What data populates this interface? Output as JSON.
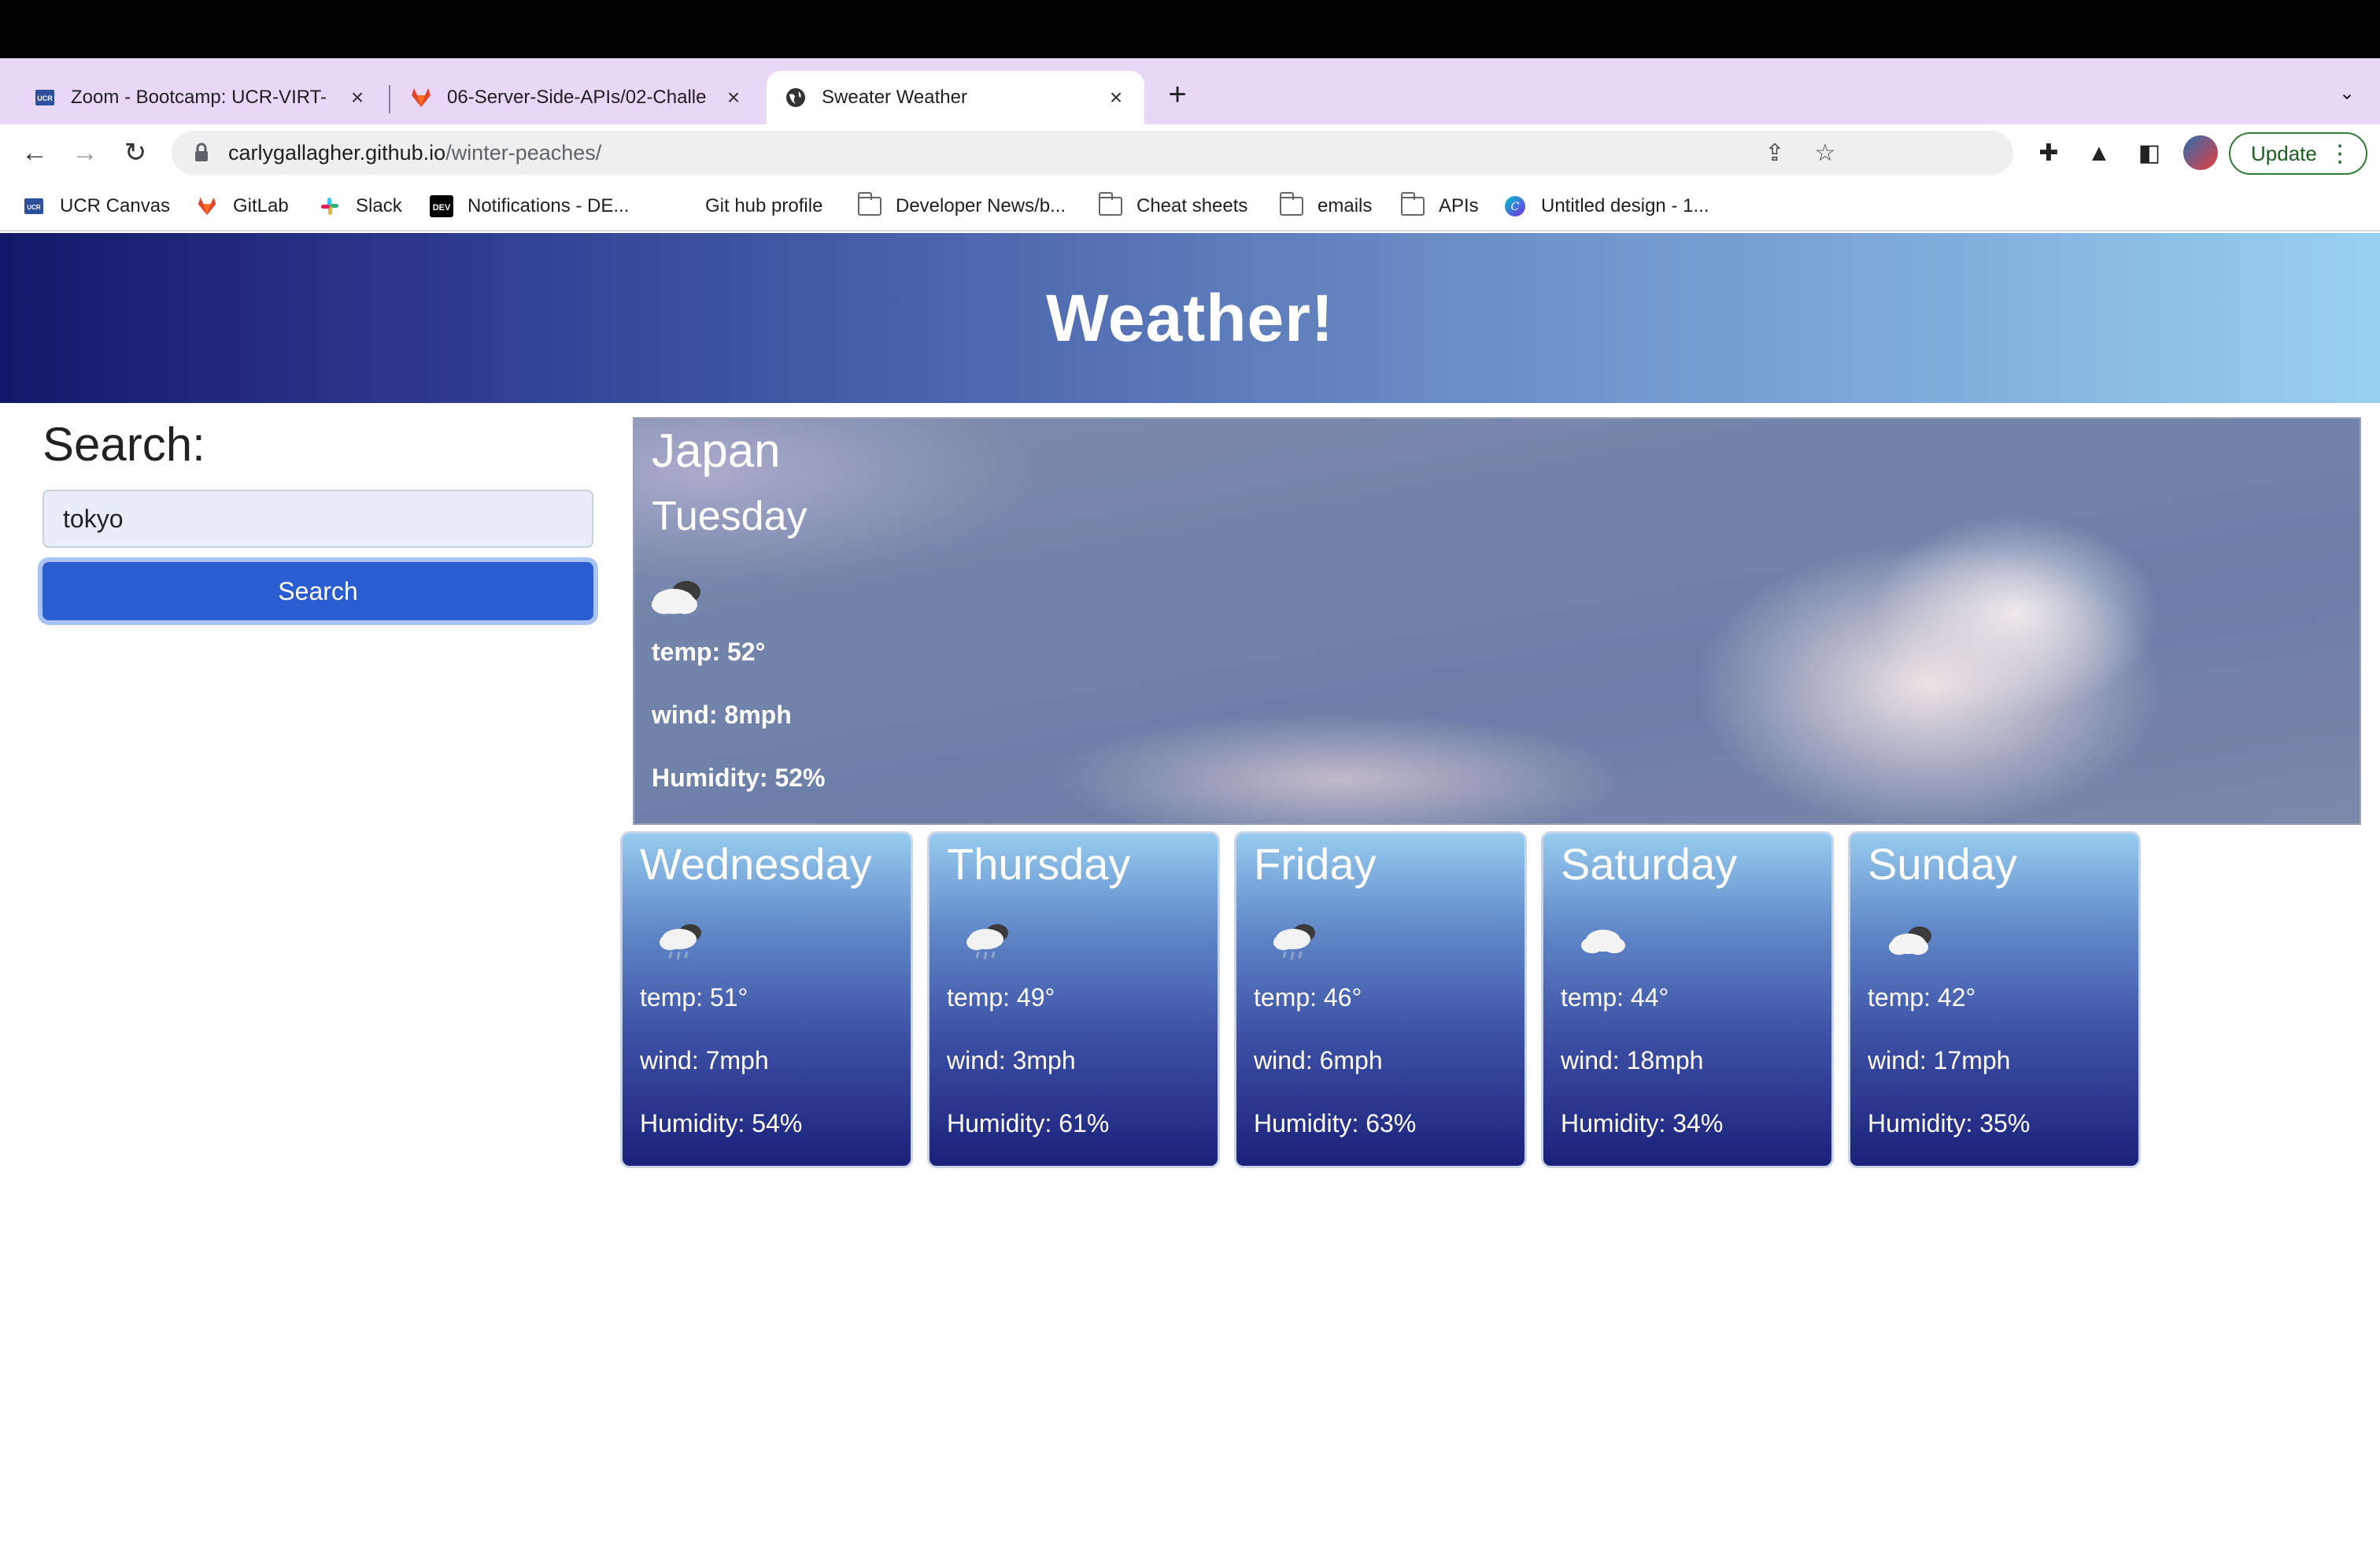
{
  "browser": {
    "tabs": [
      {
        "title": "Zoom - Bootcamp: UCR-VIRT-",
        "icon": "ucr-favicon-icon",
        "active": false
      },
      {
        "title": "06-Server-Side-APIs/02-Challe",
        "icon": "gitlab-favicon-icon",
        "active": false
      },
      {
        "title": "Sweater Weather",
        "icon": "globe-favicon-icon",
        "active": true
      }
    ],
    "url_host": "carlygallagher.github.io",
    "url_path": "/winter-peaches/",
    "update_label": "Update",
    "bookmarks": [
      {
        "label": "UCR Canvas",
        "icon": "ucr-icon"
      },
      {
        "label": "GitLab",
        "icon": "gitlab-icon"
      },
      {
        "label": "Slack",
        "icon": "slack-icon"
      },
      {
        "label": "Notifications - DE...",
        "icon": "dev-icon"
      },
      {
        "label": "Git hub profile",
        "icon": "none"
      },
      {
        "label": "Developer News/b...",
        "icon": "folder-icon"
      },
      {
        "label": "Cheat sheets",
        "icon": "folder-icon"
      },
      {
        "label": "emails",
        "icon": "folder-icon"
      },
      {
        "label": "APIs",
        "icon": "folder-icon"
      },
      {
        "label": "Untitled design - 1...",
        "icon": "canva-icon"
      }
    ]
  },
  "page": {
    "title": "Weather!",
    "search": {
      "label": "Search:",
      "value": "tokyo",
      "button": "Search"
    },
    "current": {
      "country": "Japan",
      "day": "Tuesday",
      "icon": "partly-cloudy-icon",
      "temp": "temp: 52°",
      "wind": "wind: 8mph",
      "humidity": "Humidity: 52%"
    },
    "forecast": [
      {
        "day": "Wednesday",
        "icon": "rain-cloud-icon",
        "temp": "temp: 51°",
        "wind": "wind: 7mph",
        "humidity": "Humidity: 54%"
      },
      {
        "day": "Thursday",
        "icon": "rain-cloud-icon",
        "temp": "temp: 49°",
        "wind": "wind: 3mph",
        "humidity": "Humidity: 61%"
      },
      {
        "day": "Friday",
        "icon": "rain-cloud-icon",
        "temp": "temp: 46°",
        "wind": "wind: 6mph",
        "humidity": "Humidity: 63%"
      },
      {
        "day": "Saturday",
        "icon": "cloud-icon",
        "temp": "temp: 44°",
        "wind": "wind: 18mph",
        "humidity": "Humidity: 34%"
      },
      {
        "day": "Sunday",
        "icon": "partly-cloudy-icon",
        "temp": "temp: 42°",
        "wind": "wind: 17mph",
        "humidity": "Humidity: 35%"
      }
    ]
  },
  "colors": {
    "header_dark": "#141869",
    "header_light": "#98d1f0",
    "search_button": "#2a5dcf",
    "card_bottom": "#1b217a"
  }
}
